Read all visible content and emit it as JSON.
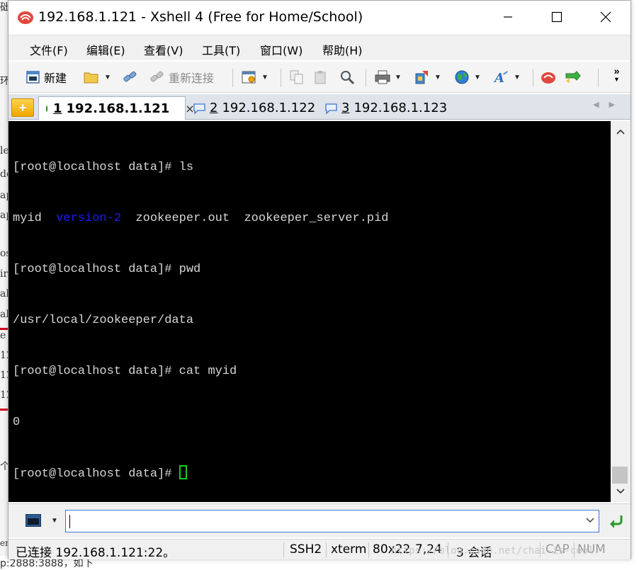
{
  "background": {
    "left_fragments": [
      "础",
      "环",
      "le",
      "de",
      "ap",
      "ap",
      "os",
      "ir",
      "al",
      "ab",
      "e",
      "12",
      "12",
      "12",
      "个"
    ],
    "bottom_text": "p:2888:3888，如下",
    "bottom_left_char": "en"
  },
  "window": {
    "title": "192.168.1.121 - Xshell 4 (Free for Home/School)"
  },
  "menu": {
    "file": "文件(F)",
    "edit": "编辑(E)",
    "view": "查看(V)",
    "tools": "工具(T)",
    "window": "窗口(W)",
    "help": "帮助(H)"
  },
  "toolbar": {
    "new_label": "新建",
    "reconnect_label": "重新连接"
  },
  "tabs": [
    {
      "num": "1",
      "label": "192.168.1.121",
      "close": "×"
    },
    {
      "num": "2",
      "label": "192.168.1.122"
    },
    {
      "num": "3",
      "label": "192.168.1.123"
    }
  ],
  "terminal": {
    "line1": "[root@localhost data]# ls",
    "line2_a": "myid  ",
    "line2_dir": "version-2",
    "line2_b": "  zookeeper.out  zookeeper_server.pid",
    "line3": "[root@localhost data]# pwd",
    "line4": "/usr/local/zookeeper/data",
    "line5": "[root@localhost data]# cat myid",
    "line6": "0",
    "line7": "[root@localhost data]# "
  },
  "command_bar": {
    "value": ""
  },
  "status": {
    "connection": "已连接 192.168.1.121:22。",
    "protocol": "SSH2",
    "term": "xterm",
    "size": "80x22",
    "cursor_pos": "7,24",
    "sessions": "3 会话",
    "caps": "CAP",
    "num": "NUM",
    "watermark": "https://blog.csdn.net/chai-is-cool"
  },
  "colors": {
    "terminal_bg": "#000000",
    "terminal_fg": "#d6d6d6",
    "dir_color": "#1a1aff",
    "cursor": "#1ec81e"
  }
}
